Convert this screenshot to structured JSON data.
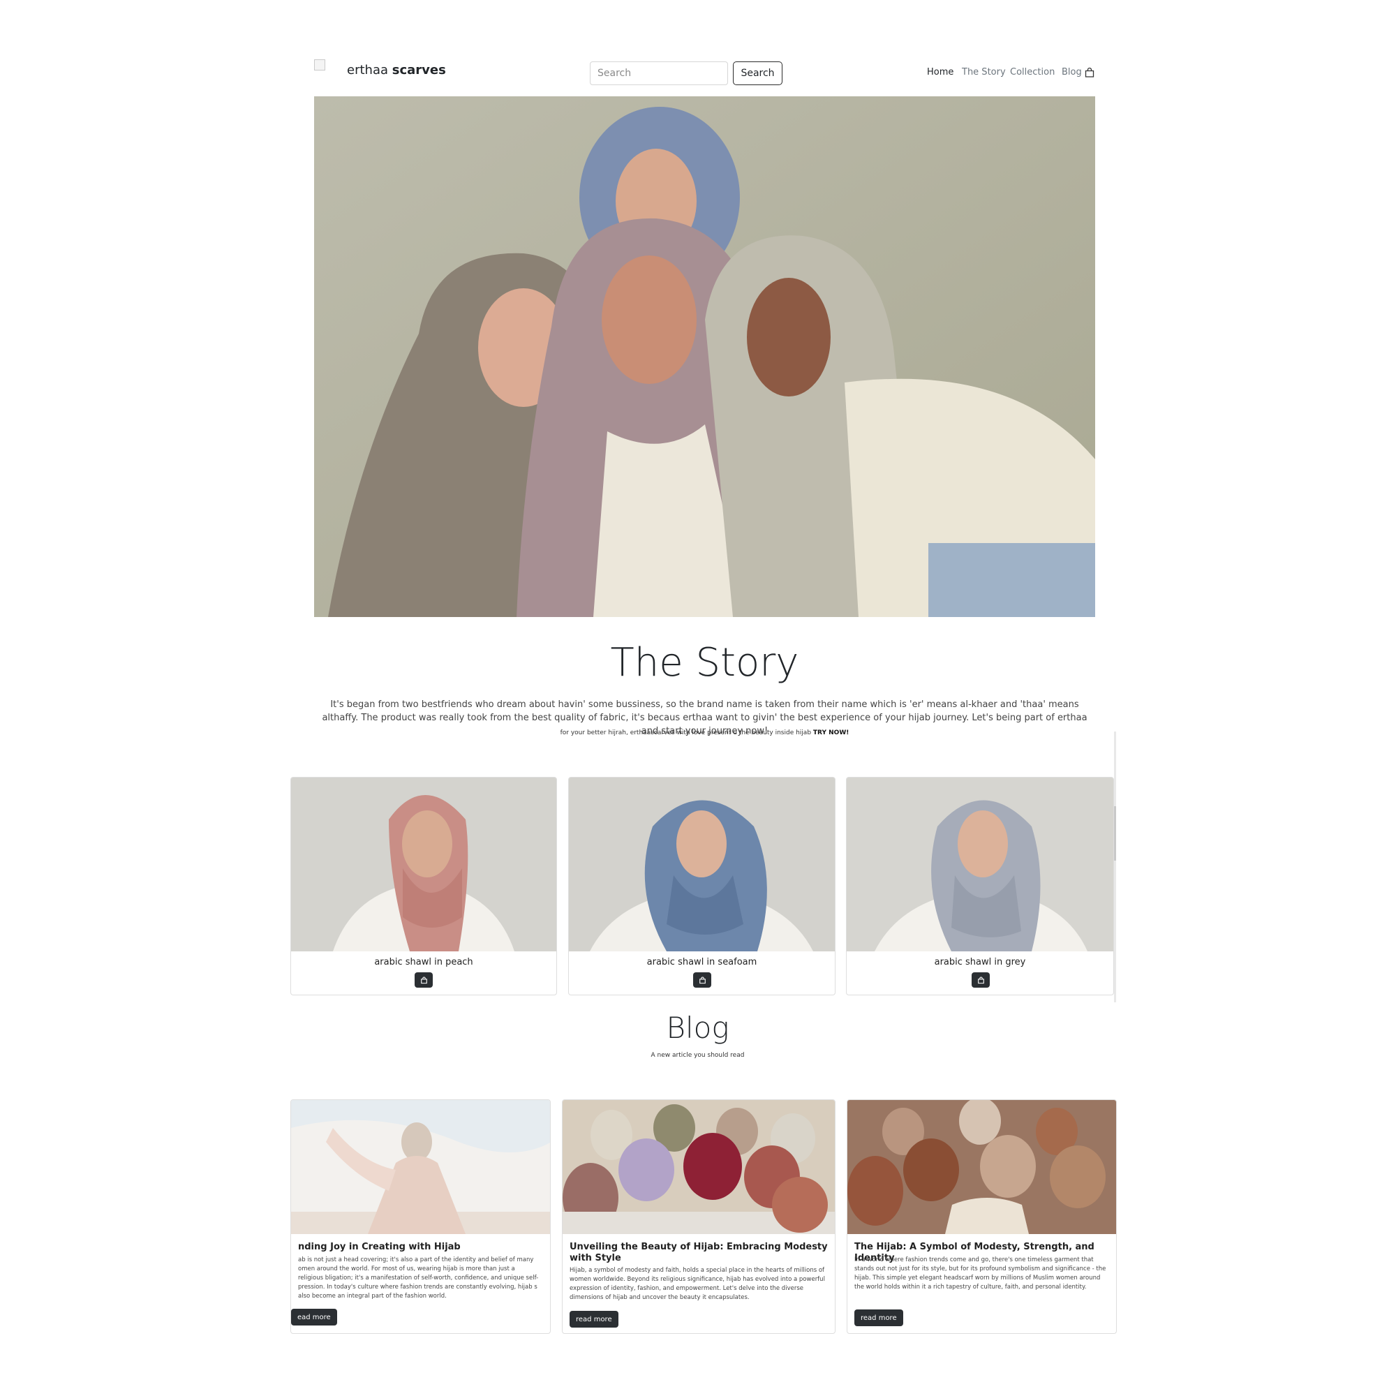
{
  "header": {
    "brand_light": "erthaa",
    "brand_bold": "scarves",
    "search_placeholder": "Search",
    "search_button": "Search",
    "nav": [
      "Home",
      "The Story",
      "Collection",
      "Blog"
    ]
  },
  "story": {
    "title": "The Story",
    "text": "It's began from two bestfriends who dream about havin' some bussiness, so the brand name is taken from their name which is 'er' means al-khaer and 'thaa' means althaffy. The product was really took from the best quality of fabric, it's becaus erthaa want to givin' the best experience of your hijab journey. Let's being part of erthaa and start your journey now!",
    "tagline": "for your better hijrah, erthaascarves with love present u the beauty inside hijab",
    "tagline_cta": "TRY NOW!"
  },
  "products": [
    {
      "name": "arabic shawl in peach"
    },
    {
      "name": "arabic shawl in seafoam"
    },
    {
      "name": "arabic shawl in grey"
    }
  ],
  "blog": {
    "title": "Blog",
    "subtitle": "A new article you should read",
    "posts": [
      {
        "title": "nding Joy in Creating with Hijab",
        "text": "ab is not just a head covering; it's also a part of the identity and belief of many omen around the world. For most of us, wearing hijab is more than just a religious bligation; it's a manifestation of self-worth, confidence, and unique self-pression. In today's culture where fashion trends are constantly evolving, hijab s also become an integral part of the fashion world.",
        "button": "ead more"
      },
      {
        "title": "Unveiling the Beauty of Hijab: Embracing Modesty with Style",
        "text": "Hijab, a symbol of modesty and faith, holds a special place in the hearts of millions of women worldwide. Beyond its religious significance, hijab has evolved into a powerful expression of identity, fashion, and empowerment. Let's delve into the diverse dimensions of hijab and uncover the beauty it encapsulates.",
        "button": "read more"
      },
      {
        "title": "The Hijab: A Symbol of Modesty, Strength, and Identity",
        "text": "In a world where fashion trends come and go, there's one timeless garment that stands out not just for its style, but for its profound symbolism and significance - the hijab. This simple yet elegant headscarf worn by millions of Muslim women around the world holds within it a rich tapestry of culture, faith, and personal identity.",
        "button": "read more"
      }
    ]
  },
  "colors": {
    "dark": "#2b2f33",
    "text": "#212529",
    "muted": "#6c757d",
    "peach": "#c98e86",
    "seafoam": "#6d87ab",
    "grey": "#a6acb9"
  },
  "icons": [
    "shopping-bag-icon"
  ]
}
